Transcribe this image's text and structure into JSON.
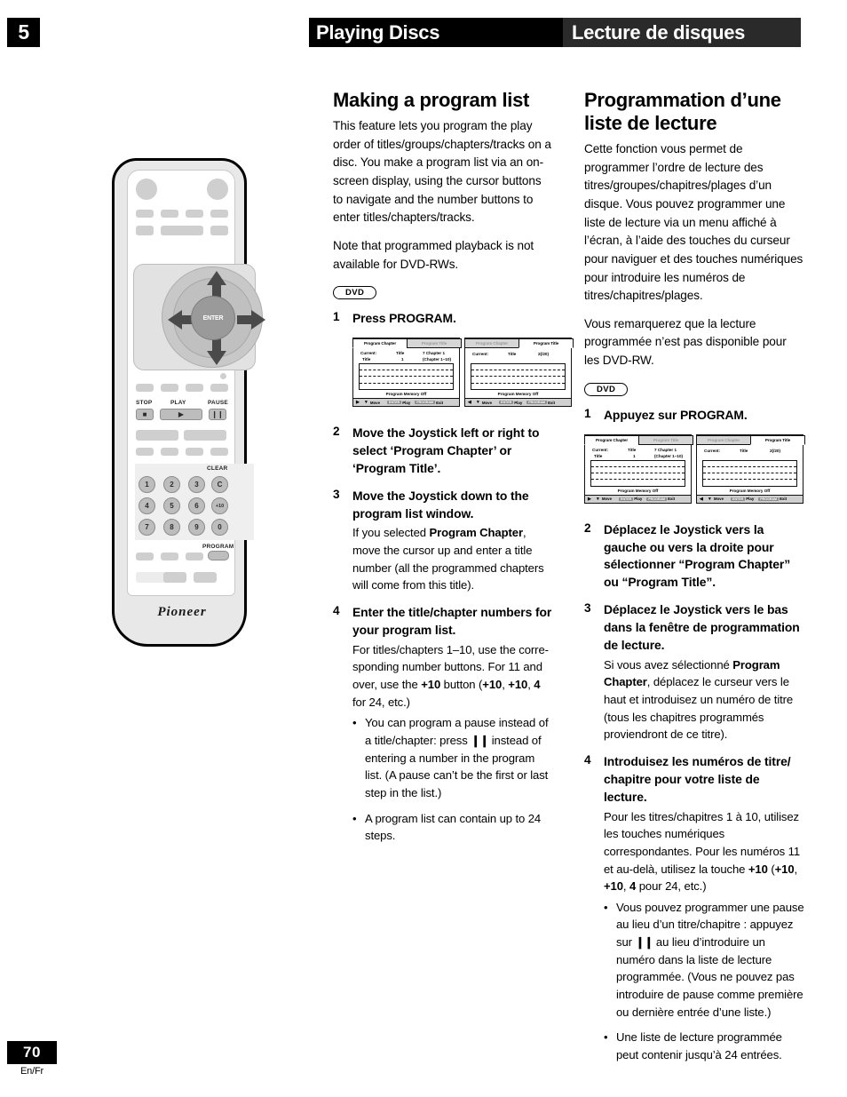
{
  "header": {
    "chapter_number": "5",
    "title_en": "Playing Discs",
    "title_fr": "Lecture de disques"
  },
  "footer": {
    "page_number": "70",
    "languages": "En/Fr"
  },
  "remote": {
    "brand": "Pioneer",
    "labels": {
      "enter": "ENTER",
      "stop": "STOP",
      "play": "PLAY",
      "pause": "PAUSE",
      "clear": "CLEAR",
      "program": "PROGRAM"
    },
    "keypad": [
      "1",
      "2",
      "3",
      "C",
      "4",
      "5",
      "6",
      "+10",
      "7",
      "8",
      "9",
      "0"
    ]
  },
  "osd": {
    "tab_chapter": "Program Chapter",
    "tab_title": "Program Title",
    "left": {
      "current_label": "Current:",
      "title_label": "Title",
      "title_sub": "Title",
      "title_value": "1",
      "chapter_value": "7  Chapter 1",
      "chapter_range": "(Chapter 1~10)"
    },
    "right": {
      "current_label": "Current:",
      "title_label": "Title",
      "title_value": "2(/20)"
    },
    "memory_label": "Program Memory   Off",
    "bar": {
      "move": "Move",
      "enter_key": "ENTER",
      "play": "Play",
      "program_key": "PROGRAM",
      "exit": "Exit"
    }
  },
  "english": {
    "heading": "Making a program list",
    "intro": "This feature lets you program the play order of titles/groups/chapters/tracks on a disc. You make a program list via an on-screen display, using the cursor buttons to navigate and the number buttons to enter titles/chapters/tracks.",
    "note": "Note that programmed playback is not available for DVD-RWs.",
    "badge": "DVD",
    "steps": [
      {
        "num": "1",
        "title": "Press PROGRAM.",
        "note": ""
      },
      {
        "num": "2",
        "title": "Move the Joystick left or right to select ‘Program Chapter’ or ‘Program Title’.",
        "note": ""
      },
      {
        "num": "3",
        "title": "Move the Joystick down to the program list window.",
        "note_prefix": "If you selected ",
        "note_bold": "Program Chapter",
        "note_suffix": ", move the cursor up and enter a title number (all the programmed chapters will come from this title)."
      },
      {
        "num": "4",
        "title": "Enter the title/chapter numbers for your program list.",
        "note_a": "For titles/chapters 1–10, use the corre-sponding number buttons. For 11 and over, use the ",
        "note_b": "+10",
        "note_c": " button (",
        "note_d": "+10",
        "note_e": ", ",
        "note_f": "+10",
        "note_g": ", ",
        "note_h": "4",
        "note_i": " for 24, etc.)"
      }
    ],
    "bullets": [
      {
        "pre": "You can program a pause instead of a title/chapter: press ",
        "glyph": "❙❙",
        "post": " instead of entering a number in the program list. (A pause can’t be the first or last step in the list.)"
      },
      {
        "pre": "A program list can contain up to 24 steps.",
        "glyph": "",
        "post": ""
      }
    ]
  },
  "french": {
    "heading": "Programmation d’une liste de lecture",
    "intro": "Cette fonction vous permet de programmer l’ordre de lecture des titres/groupes/chapitres/plages d’un disque. Vous pouvez programmer une liste de lecture via un menu affiché à l’écran, à l’aide des touches du curseur pour naviguer et des touches numériques pour introduire les numéros de titres/chapitres/plages.",
    "note": "Vous remarquerez que la lecture programmée n’est pas disponible pour les DVD-RW.",
    "badge": "DVD",
    "steps": [
      {
        "num": "1",
        "title": "Appuyez sur PROGRAM.",
        "note": ""
      },
      {
        "num": "2",
        "title": "Déplacez le Joystick vers la gauche ou vers la droite pour sélectionner “Program Chapter” ou “Program Title”.",
        "note": ""
      },
      {
        "num": "3",
        "title": "Déplacez le Joystick vers le bas dans la fenêtre de programmation de lecture.",
        "note_prefix": "Si vous avez sélectionné ",
        "note_bold": "Program Chapter",
        "note_suffix": ", déplacez le curseur vers le haut et introduisez un numéro de titre (tous les chapitres programmés proviendront de ce titre)."
      },
      {
        "num": "4",
        "title": "Introduisez les numéros de titre/ chapitre pour votre liste de lecture.",
        "note_a": "Pour les titres/chapitres 1 à 10, utilisez les touches numériques correspondantes. Pour les numéros 11 et au-delà, utilisez la touche ",
        "note_b": "+10",
        "note_c": " (",
        "note_d": "+10",
        "note_e": ", ",
        "note_f": "+10",
        "note_g": ", ",
        "note_h": "4",
        "note_i": " pour 24, etc.)"
      }
    ],
    "bullets": [
      {
        "pre": "Vous pouvez programmer une pause au lieu d’un titre/chapitre : appuyez sur ",
        "glyph": "❙❙",
        "post": " au lieu d’introduire un numéro dans la liste de lecture programmée. (Vous ne pouvez pas introduire de pause comme première ou dernière entrée d’une liste.)"
      },
      {
        "pre": "Une liste de lecture programmée peut contenir jusqu’à 24 entrées.",
        "glyph": "",
        "post": ""
      }
    ]
  }
}
